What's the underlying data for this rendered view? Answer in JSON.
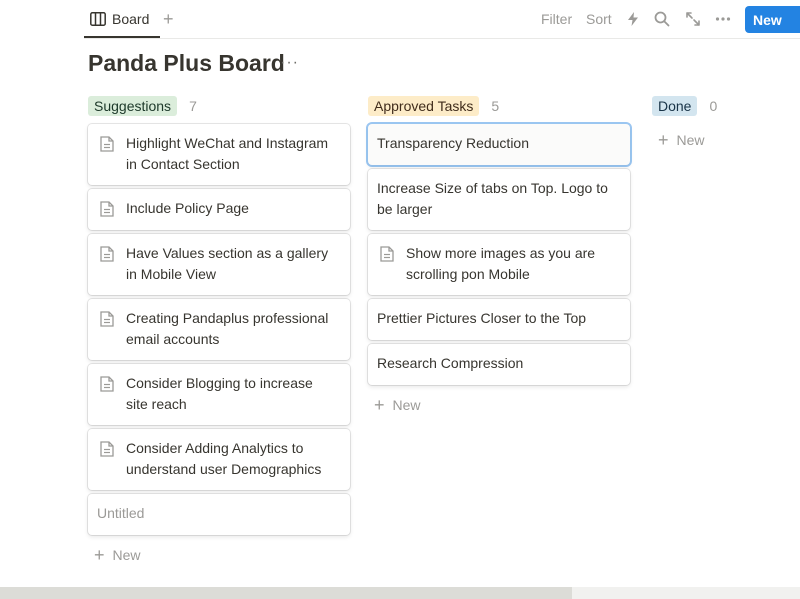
{
  "toolbar": {
    "view_label": "Board",
    "filter_label": "Filter",
    "sort_label": "Sort",
    "new_label": "New",
    "icons": [
      "board-view-icon",
      "add-view-icon",
      "automation-bolt-icon",
      "search-icon",
      "expand-icon",
      "more-icon"
    ]
  },
  "page": {
    "title": "Panda Plus Board",
    "more": "···"
  },
  "columns": [
    {
      "name": "Suggestions",
      "count": "7",
      "tag_color": "#dbeddb",
      "tag_text_color": "#1c3829",
      "cards": [
        "Highlight WeChat and Instagram in Contact Section",
        "Include Policy Page",
        "Have Values section as a gallery in Mobile View",
        "Creating Pandaplus professional email accounts",
        "Consider Blogging to increase site reach",
        "Consider Adding Analytics to understand user Demographics",
        "Untitled"
      ],
      "new_label": "New"
    },
    {
      "name": "Approved Tasks",
      "count": "5",
      "tag_color": "#fdecc8",
      "tag_text_color": "#402c1b",
      "cards": [
        "Transparency Reduction",
        "Increase Size of tabs on Top. Logo to be larger",
        "Show more images as you are scrolling pon Mobile",
        "Prettier Pictures Closer to the Top",
        "Research Compression"
      ],
      "new_label": "New"
    },
    {
      "name": "Done",
      "count": "0",
      "tag_color": "#d3e5ef",
      "tag_text_color": "#183347",
      "cards": [],
      "new_label": "New"
    }
  ]
}
